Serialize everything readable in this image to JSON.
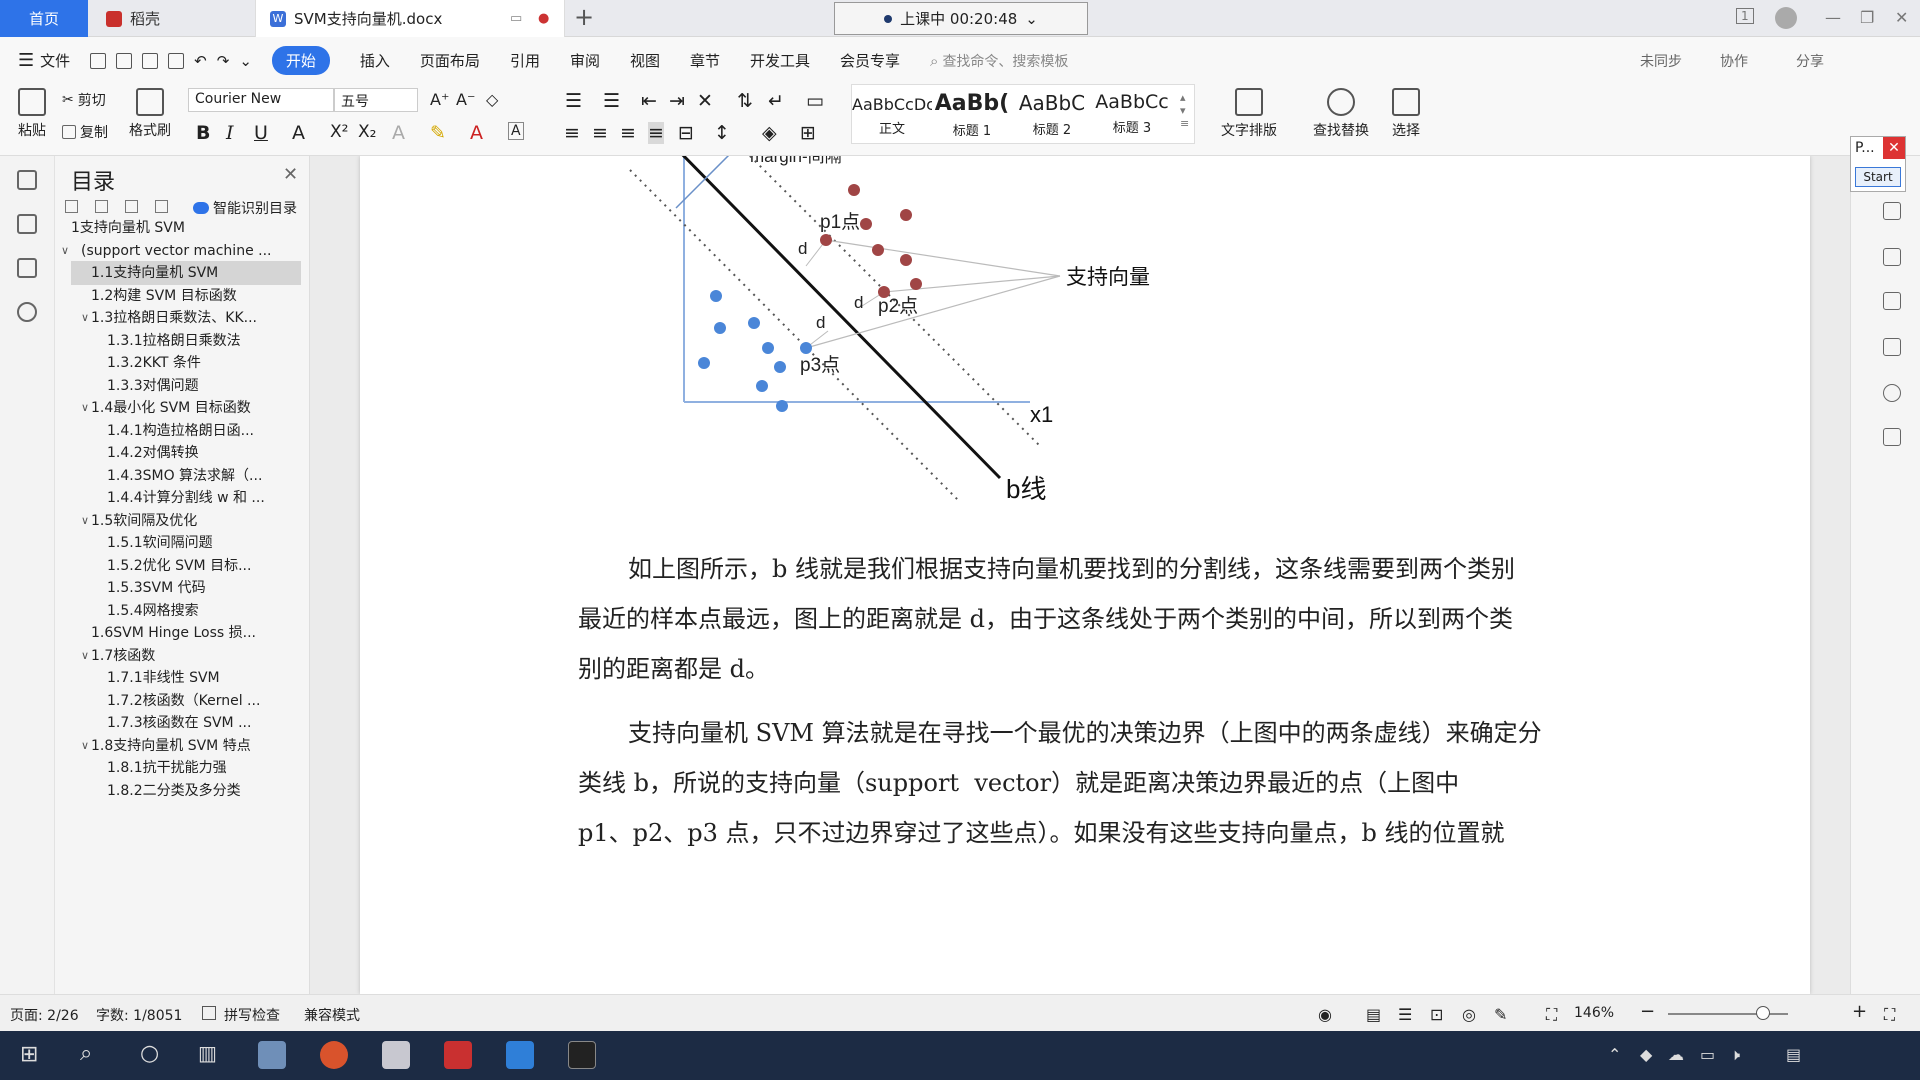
{
  "titlebar": {
    "home_tab": "首页",
    "docer_tab": "稻壳",
    "doc_tab": "SVM支持向量机.docx",
    "meeting": "上课中 00:20:48",
    "chevron": "⌄",
    "new_tab": "+",
    "page_badge": "1"
  },
  "menu": {
    "file": "文件",
    "items": [
      "开始",
      "插入",
      "页面布局",
      "引用",
      "审阅",
      "视图",
      "章节",
      "开发工具",
      "会员专享"
    ],
    "search_placeholder": "查找命令、搜索模板",
    "sync": "未同步",
    "collab": "协作",
    "share": "分享"
  },
  "ribbon": {
    "paste": "粘贴",
    "cut": "剪切",
    "copy": "复制",
    "format_painter": "格式刷",
    "font_name": "Courier New",
    "font_size": "五号",
    "bold": "B",
    "italic": "I",
    "underline": "U",
    "styles": [
      {
        "preview": "AaBbCcDc",
        "label": "正文"
      },
      {
        "preview": "AaBb(",
        "label": "标题 1"
      },
      {
        "preview": "AaBbC",
        "label": "标题 2"
      },
      {
        "preview": "AaBbCc",
        "label": "标题 3"
      }
    ],
    "text_layout": "文字排版",
    "find_replace": "查找替换",
    "select": "选择"
  },
  "toc": {
    "title": "目录",
    "smart": "智能识别目录",
    "items": [
      {
        "label": "1支持向量机 SVM",
        "level": 0,
        "arrow": ""
      },
      {
        "label": "(support vector machine ...",
        "level": 0,
        "arrow": "v"
      },
      {
        "label": "1.1支持向量机 SVM",
        "level": 1,
        "arrow": "",
        "selected": true
      },
      {
        "label": "1.2构建 SVM 目标函数",
        "level": 1,
        "arrow": ""
      },
      {
        "label": "1.3拉格朗日乘数法、KK...",
        "level": 1,
        "arrow": "v"
      },
      {
        "label": "1.3.1拉格朗日乘数法",
        "level": 2,
        "arrow": ""
      },
      {
        "label": "1.3.2KKT 条件",
        "level": 2,
        "arrow": ""
      },
      {
        "label": "1.3.3对偶问题",
        "level": 2,
        "arrow": ""
      },
      {
        "label": "1.4最小化 SVM 目标函数",
        "level": 1,
        "arrow": "v"
      },
      {
        "label": "1.4.1构造拉格朗日函...",
        "level": 2,
        "arrow": ""
      },
      {
        "label": "1.4.2对偶转换",
        "level": 2,
        "arrow": ""
      },
      {
        "label": "1.4.3SMO 算法求解（...",
        "level": 2,
        "arrow": ""
      },
      {
        "label": "1.4.4计算分割线 w 和 ...",
        "level": 2,
        "arrow": ""
      },
      {
        "label": "1.5软间隔及优化",
        "level": 1,
        "arrow": "v"
      },
      {
        "label": "1.5.1软间隔问题",
        "level": 2,
        "arrow": ""
      },
      {
        "label": "1.5.2优化 SVM 目标...",
        "level": 2,
        "arrow": ""
      },
      {
        "label": "1.5.3SVM 代码",
        "level": 2,
        "arrow": ""
      },
      {
        "label": "1.5.4网格搜索",
        "level": 2,
        "arrow": ""
      },
      {
        "label": "1.6SVM Hinge Loss 损...",
        "level": 1,
        "arrow": ""
      },
      {
        "label": "1.7核函数",
        "level": 1,
        "arrow": "v"
      },
      {
        "label": "1.7.1非线性 SVM",
        "level": 2,
        "arrow": ""
      },
      {
        "label": "1.7.2核函数（Kernel ...",
        "level": 2,
        "arrow": ""
      },
      {
        "label": "1.7.3核函数在 SVM ...",
        "level": 2,
        "arrow": ""
      },
      {
        "label": "1.8支持向量机 SVM 特点",
        "level": 1,
        "arrow": "v"
      },
      {
        "label": "1.8.1抗干扰能力强",
        "level": 2,
        "arrow": ""
      },
      {
        "label": "1.8.2二分类及多分类",
        "level": 2,
        "arrow": ""
      }
    ]
  },
  "figure": {
    "margin_label": "margin-间隔",
    "p1": "p1点",
    "p2": "p2点",
    "p3": "p3点",
    "d": "d",
    "support_vectors": "支持向量",
    "x1": "x1",
    "b_line": "b线",
    "red_color": "#a04545",
    "blue_color": "#4a86d8"
  },
  "document": {
    "para1_line1": "如上图所示，b 线就是我们根据支持向量机要找到的分割线，这条线需要到两个类别",
    "para1_line2": "最近的样本点最远，图上的距离就是 d，由于这条线处于两个类别的中间，所以到两个类",
    "para1_line3": "别的距离都是 d。",
    "para2_line1": "支持向量机 SVM 算法就是在寻找一个最优的决策边界（上图中的两条虚线）来确定分",
    "para2_line2": "类线 b，所说的支持向量（support  vector）就是距离决策边界最近的点（上图中",
    "para2_line3": "p1、p2、p3 点，只不过边界穿过了这些点）。如果没有这些支持向量点，b 线的位置就"
  },
  "pwidget": {
    "title": "P...",
    "start": "Start"
  },
  "status": {
    "page": "页面: 2/26",
    "words": "字数: 1/8051",
    "spell": "拼写检查",
    "compat": "兼容模式",
    "zoom": "146%"
  }
}
